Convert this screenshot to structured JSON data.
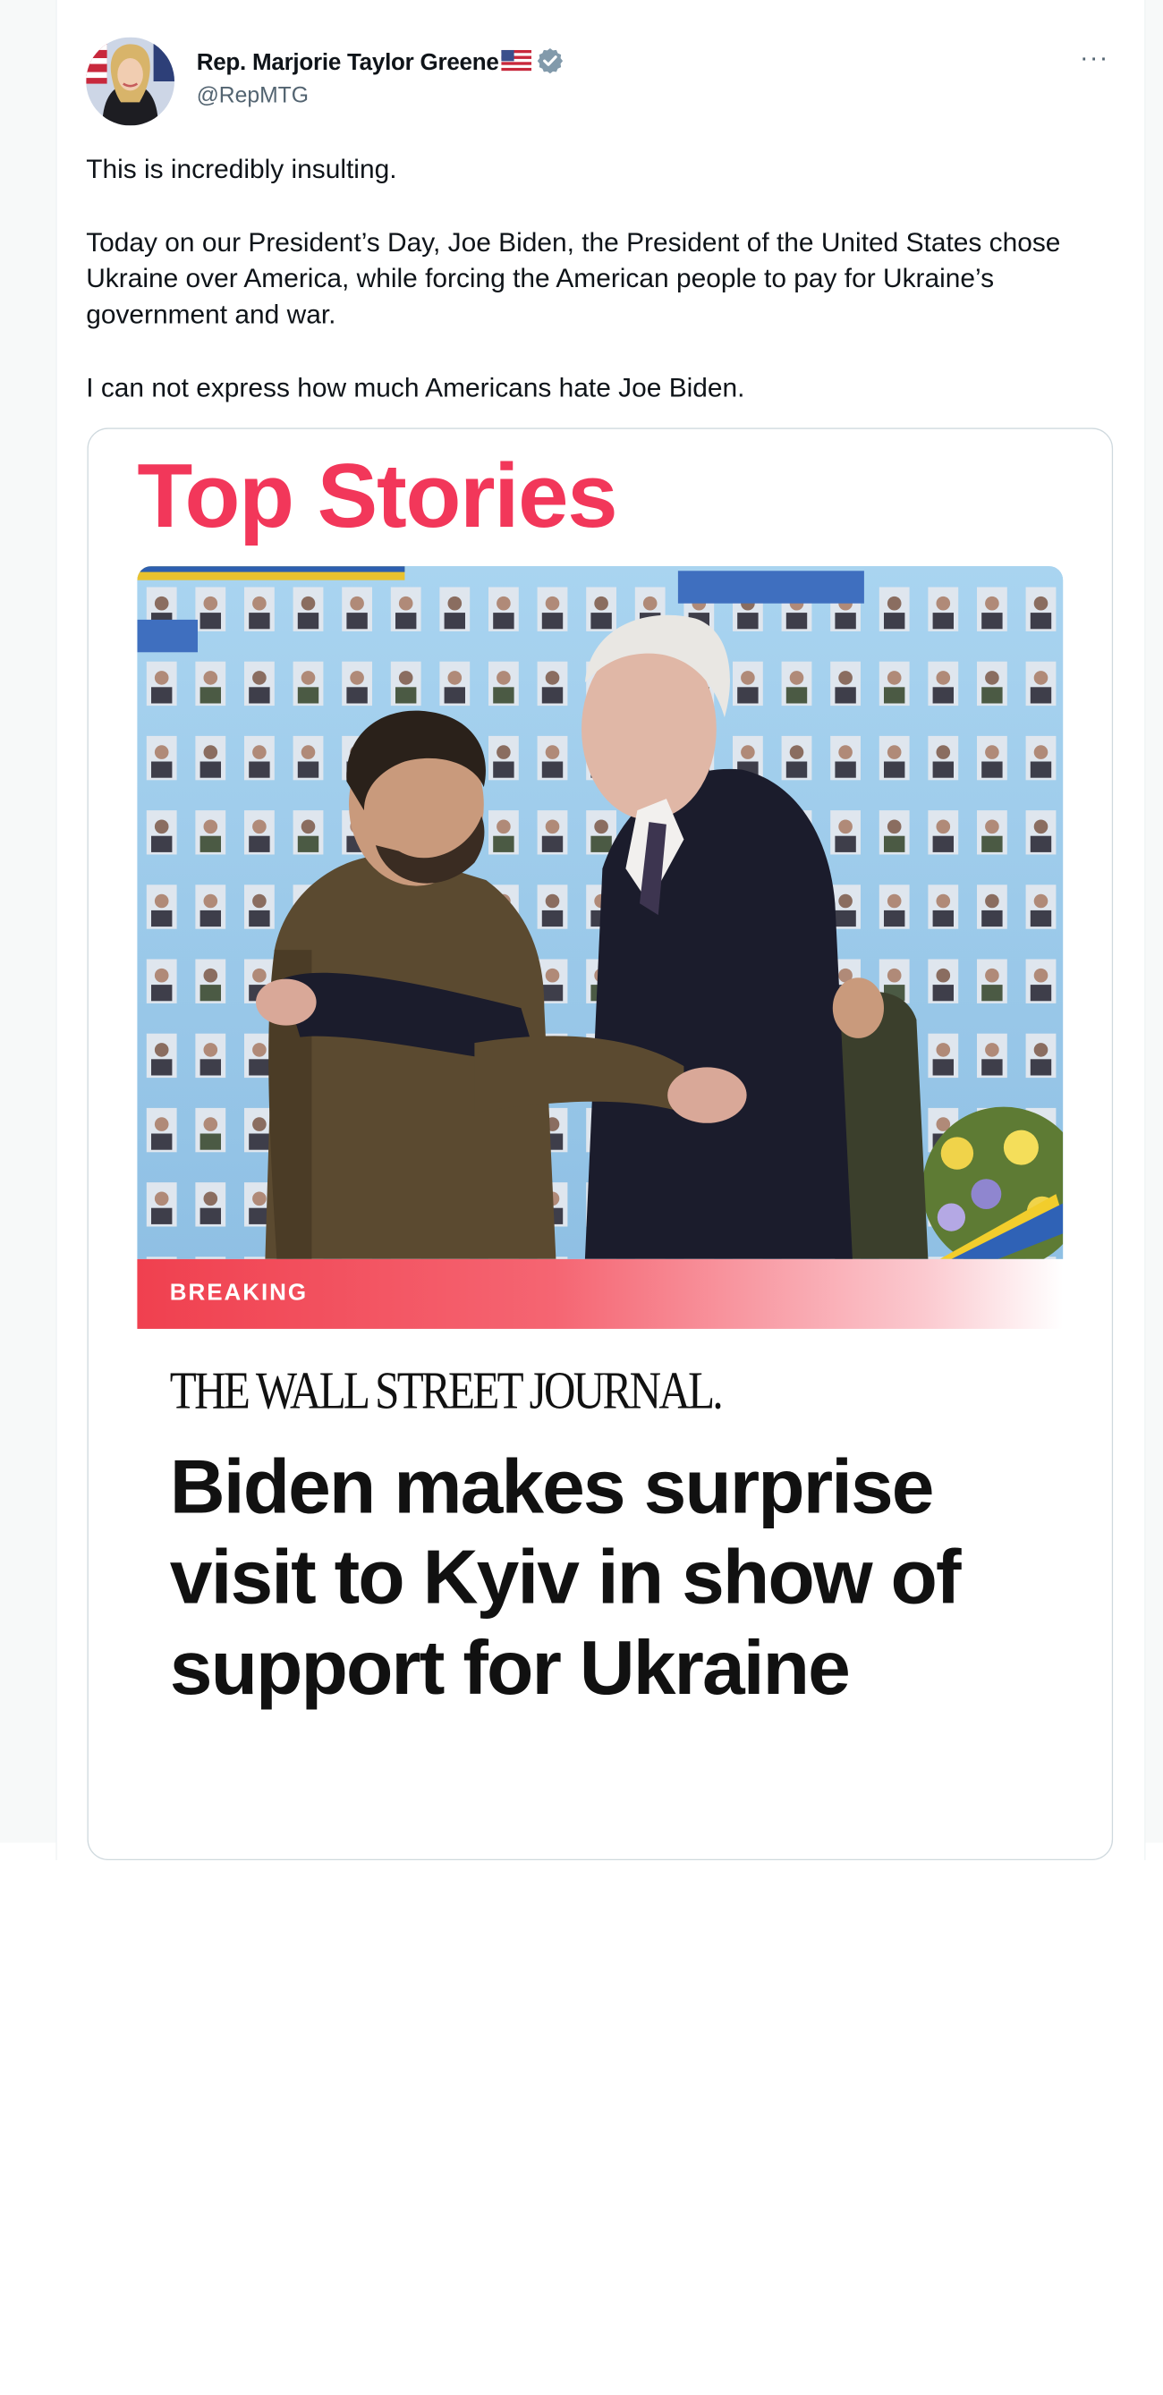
{
  "tweet": {
    "author_name": "Rep. Marjorie Taylor Greene",
    "author_handle": "@RepMTG",
    "more_label": "···",
    "icons": [
      "us-flag-icon",
      "verified-badge-icon",
      "more-options-icon"
    ],
    "paragraphs": [
      "This is incredibly insulting.",
      "Today on our President’s Day, Joe Biden, the President of the United States chose Ukraine over America, while forcing the American people to pay for Ukraine’s government and war.",
      "I can not express how much Americans hate Joe Biden."
    ]
  },
  "card": {
    "section_title": "Top Stories",
    "badge": "BREAKING",
    "publisher": "THE WALL STREET JOURNAL.",
    "headline": "Biden makes surprise visit to Kyiv in show of support for Ukraine"
  },
  "colors": {
    "text_primary": "#0f1419",
    "text_secondary": "#536471",
    "verified": "#829aab",
    "top_stories_accent": "#f2375a",
    "breaking_bar": "#f0404f",
    "card_border": "#cfd9de"
  }
}
